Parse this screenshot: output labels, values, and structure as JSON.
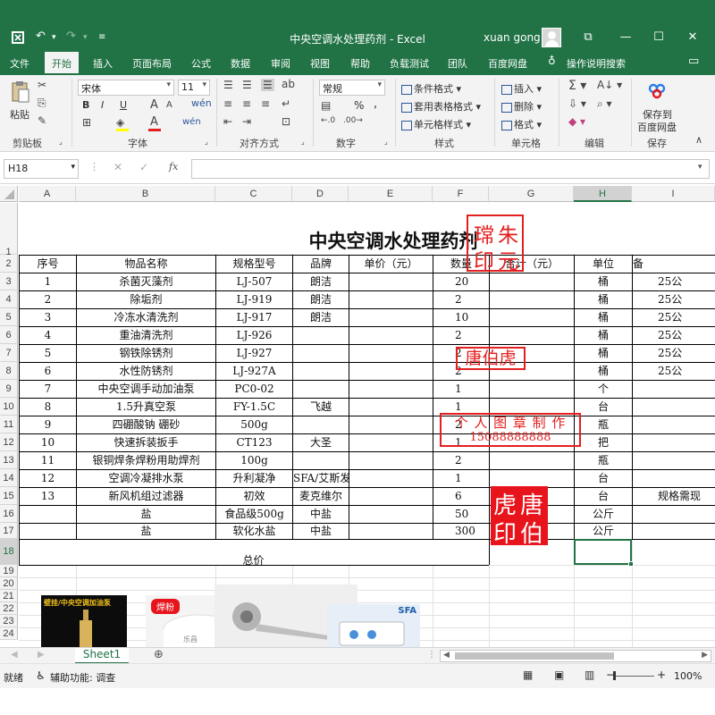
{
  "window": {
    "title": "中央空调水处理药剂  -  Excel",
    "user": "xuan gong",
    "controls": [
      "⧉",
      "—",
      "☐",
      "✕"
    ]
  },
  "ribbon_tabs": [
    "文件",
    "开始",
    "插入",
    "页面布局",
    "公式",
    "数据",
    "审阅",
    "视图",
    "帮助",
    "负载测试",
    "团队",
    "百度网盘",
    "操作说明搜索"
  ],
  "active_tab": "开始",
  "ribbon": {
    "clipboard": {
      "paste": "粘贴",
      "label": "剪贴板"
    },
    "font": {
      "name": "宋体",
      "size": "11",
      "bold": "B",
      "italic": "I",
      "underline": "U",
      "label": "字体"
    },
    "alignment": {
      "label": "对齐方式"
    },
    "number": {
      "format": "常规",
      "percent": "%",
      "comma": ",",
      "label": "数字"
    },
    "styles": {
      "conditional": "条件格式",
      "table": "套用表格格式",
      "cell": "单元格样式",
      "label": "样式"
    },
    "cells": {
      "insert": "插入",
      "delete": "删除",
      "format": "格式",
      "label": "单元格"
    },
    "editing": {
      "label": "编辑"
    },
    "save": {
      "line1": "保存到",
      "line2": "百度网盘",
      "label": "保存"
    }
  },
  "formula_bar": {
    "name_box": "H18",
    "fx": "fx",
    "value": ""
  },
  "sheet": {
    "columns": [
      "A",
      "B",
      "C",
      "D",
      "E",
      "F",
      "G",
      "H",
      "I"
    ],
    "rows": [
      "1",
      "2",
      "3",
      "4",
      "5",
      "6",
      "7",
      "8",
      "9",
      "10",
      "11",
      "12",
      "13",
      "14",
      "15",
      "16",
      "17",
      "18",
      "19",
      "20",
      "21",
      "22",
      "23",
      "24"
    ],
    "selected_cell": "H18",
    "title": "中央空调水处理药剂",
    "headers": [
      "序号",
      "物品名称",
      "规格型号",
      "品牌",
      "单价（元）",
      "数量",
      "合计（元）",
      "单位",
      "备"
    ],
    "data": [
      [
        "1",
        "杀菌灭藻剂",
        "LJ-507",
        "朗洁",
        "",
        "20",
        "",
        "桶",
        "25公"
      ],
      [
        "2",
        "除垢剂",
        "LJ-919",
        "朗洁",
        "",
        "2",
        "",
        "桶",
        "25公"
      ],
      [
        "3",
        "冷冻水清洗剂",
        "LJ-917",
        "朗洁",
        "",
        "10",
        "",
        "桶",
        "25公"
      ],
      [
        "4",
        "重油清洗剂",
        "LJ-926",
        "",
        "",
        "2",
        "",
        "桶",
        "25公"
      ],
      [
        "5",
        "钢铁除锈剂",
        "LJ-927",
        "",
        "",
        "2",
        "",
        "桶",
        "25公"
      ],
      [
        "6",
        "水性防锈剂",
        "LJ-927A",
        "",
        "",
        "2",
        "",
        "桶",
        "25公"
      ],
      [
        "7",
        "中央空调手动加油泵",
        "PC0-02",
        "",
        "",
        "1",
        "",
        "个",
        ""
      ],
      [
        "8",
        "1.5升真空泵",
        "FY-1.5C",
        "飞越",
        "",
        "1",
        "",
        "台",
        ""
      ],
      [
        "9",
        "四硼酸钠 硼砂",
        "500g",
        "",
        "",
        "2",
        "",
        "瓶",
        ""
      ],
      [
        "10",
        "快速拆装扳手",
        "CT123",
        "大圣",
        "",
        "1",
        "",
        "把",
        ""
      ],
      [
        "11",
        "银铜焊条焊粉用助焊剂",
        "100g",
        "",
        "",
        "2",
        "",
        "瓶",
        ""
      ],
      [
        "12",
        "空调冷凝排水泵",
        "升利凝净",
        "SFA/艾斯发",
        "",
        "1",
        "",
        "台",
        ""
      ],
      [
        "13",
        "新风机组过滤器",
        "初效",
        "麦克维尔",
        "",
        "6",
        "",
        "台",
        "规格需现"
      ],
      [
        "",
        "盐",
        "食品级500g",
        "中盐",
        "",
        "50",
        "",
        "公斤",
        ""
      ],
      [
        "",
        "盐",
        "软化水盐",
        "中盐",
        "",
        "300",
        "",
        "公斤",
        ""
      ]
    ],
    "total_label": "总价"
  },
  "stamps": {
    "seal_square": [
      "瑺",
      "朱",
      "印",
      "元"
    ],
    "seal_name": "唐伯虎",
    "seal_personal_line1": "个 人 图 章 制 作",
    "seal_personal_line2": "15088888888",
    "seal_filled": [
      "虎",
      "唐",
      "印",
      "伯"
    ]
  },
  "images": {
    "img1_text": "壁挂/中央空调加油泵",
    "img2_text": "焊粉",
    "img2_subtext": "乐昌",
    "img4_text": "SFA"
  },
  "sheet_tabs": [
    "Sheet1"
  ],
  "status": {
    "ready": "就绪",
    "accessibility": "辅助功能: 调查",
    "zoom": "100%"
  },
  "colors": {
    "excel_green": "#217346",
    "stamp_red": "#e41f1f"
  }
}
